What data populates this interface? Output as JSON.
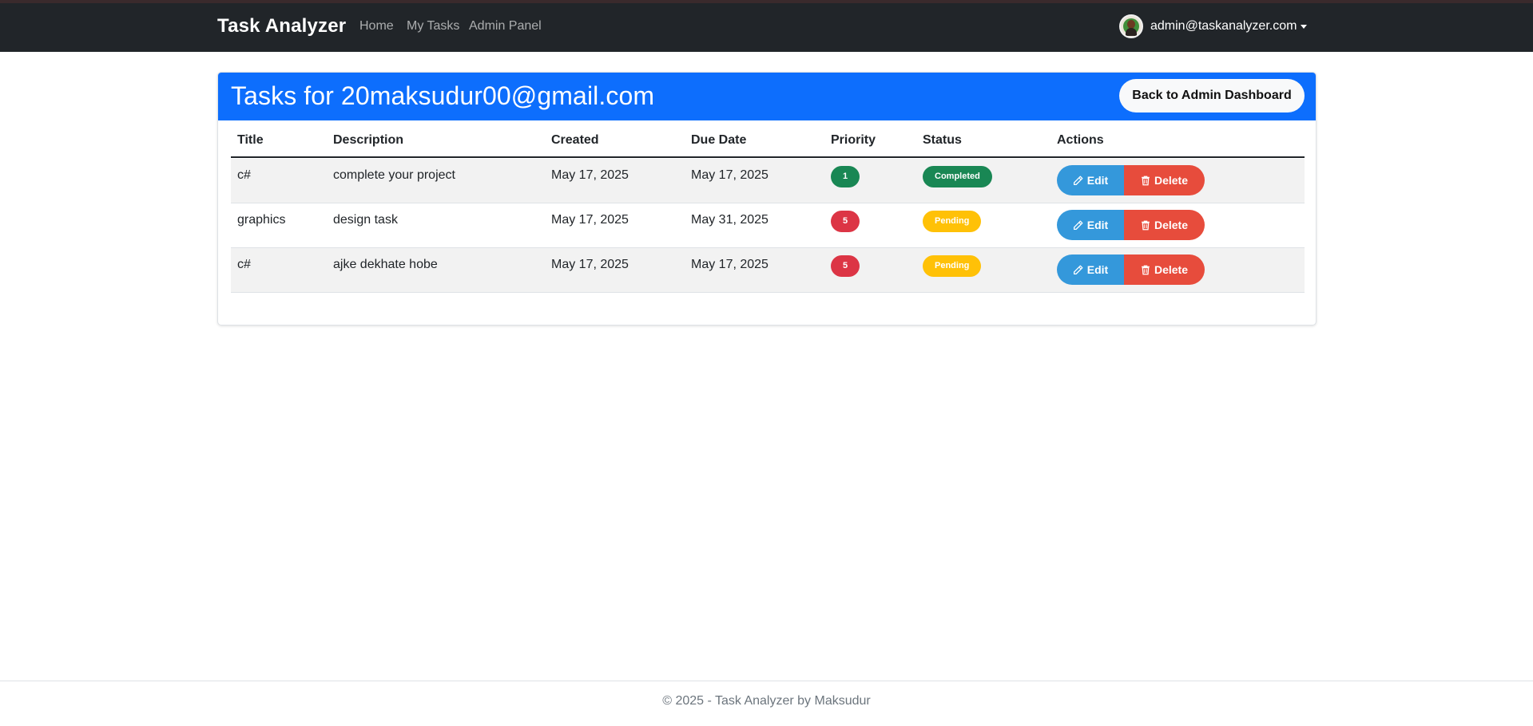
{
  "navbar": {
    "brand": "Task Analyzer",
    "links": [
      "Home",
      "My Tasks",
      "Admin Panel"
    ],
    "user_email": "admin@taskanalyzer.com"
  },
  "card": {
    "title": "Tasks for 20maksudur00@gmail.com",
    "back_button_label": "Back to Admin Dashboard",
    "header_color": "#0d6efd"
  },
  "table": {
    "columns": [
      "Title",
      "Description",
      "Created",
      "Due Date",
      "Priority",
      "Status",
      "Actions"
    ],
    "rows": [
      {
        "title": "c#",
        "description": "complete your project",
        "created": "May 17, 2025",
        "due": "May 17, 2025",
        "priority": "1",
        "priority_color": "#198754",
        "status": "Completed",
        "status_color": "#198754",
        "status_text_color": "#ffffff"
      },
      {
        "title": "graphics",
        "description": "design task",
        "created": "May 17, 2025",
        "due": "May 31, 2025",
        "priority": "5",
        "priority_color": "#dc3545",
        "status": "Pending",
        "status_color": "#ffc107",
        "status_text_color": "#ffffff"
      },
      {
        "title": "c#",
        "description": "ajke dekhate hobe",
        "created": "May 17, 2025",
        "due": "May 17, 2025",
        "priority": "5",
        "priority_color": "#dc3545",
        "status": "Pending",
        "status_color": "#ffc107",
        "status_text_color": "#ffffff"
      }
    ],
    "edit_label": "Edit",
    "delete_label": "Delete",
    "edit_icon": "pencil-icon",
    "delete_icon": "trash-icon"
  },
  "footer": {
    "text": "© 2025 - Task Analyzer by Maksudur"
  }
}
